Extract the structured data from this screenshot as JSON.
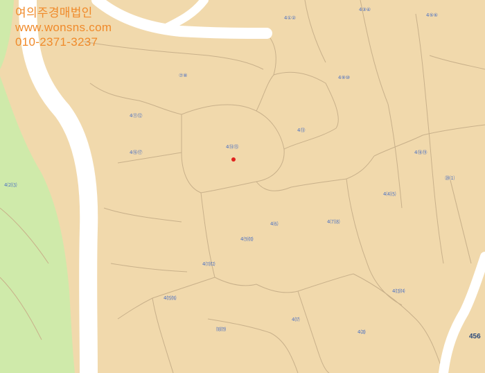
{
  "watermark": {
    "company": "여의주경매법인",
    "website": "www.wonsns.com",
    "phone": "010-2371-3237"
  },
  "map": {
    "land_color": "#f1d9ac",
    "forest_color": "#cfeaaa",
    "road_color": "#ffffff",
    "boundary_color": "#c8b08a",
    "label_color": "#4a6fc2",
    "marker_color": "#e0221e",
    "road_number": "456",
    "parcel_labels": [
      "4①②",
      "4③④",
      "4⑤⑥",
      "⑦⑧",
      "4⑨⑩",
      "4⑪⑫",
      "4⑬",
      "4⑭⑮",
      "4⑯⑰",
      "4⑱⑲",
      "⑳⑴",
      "4⑵⑶",
      "4⑷⑸",
      "4⑹",
      "4⑺⑻",
      "4⑼⑽",
      "4⑾⑿",
      "4⒀⒁",
      "4⒂⒃",
      "4⒄",
      "⒅⒆",
      "4⒇"
    ]
  }
}
